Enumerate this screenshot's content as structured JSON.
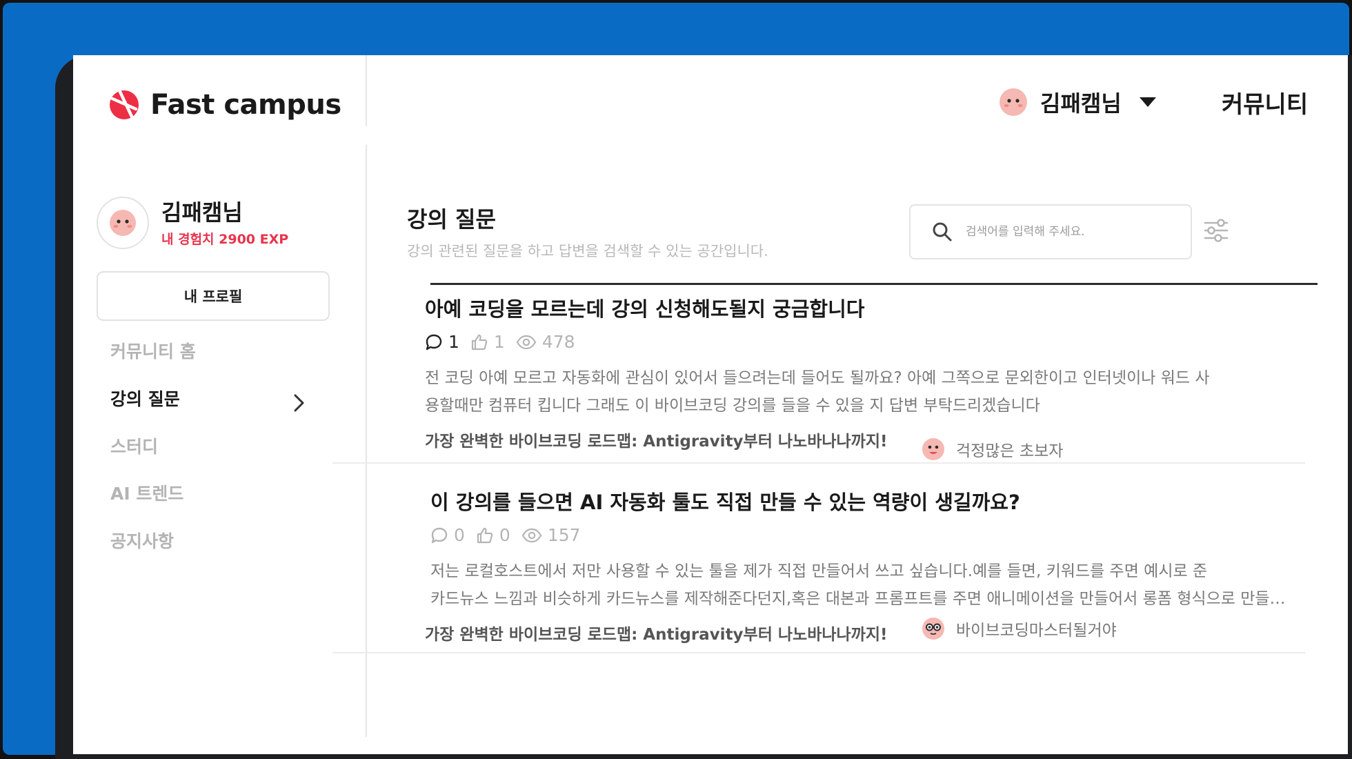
{
  "header": {
    "logo_text": "Fast campus",
    "user_name": "김패캠님",
    "community_label": "커뮤니티"
  },
  "sidebar": {
    "profile_name": "김패캠님",
    "profile_exp": "내 경험치 2900 EXP",
    "profile_button": "내 프로필",
    "nav": [
      {
        "label": "커뮤니티 홈"
      },
      {
        "label": "강의 질문"
      },
      {
        "label": "스터디"
      },
      {
        "label": "AI 트렌드"
      },
      {
        "label": "공지사항"
      }
    ]
  },
  "main": {
    "title": "강의 질문",
    "description": "강의 관련된 질문을 하고 답변을 검색할 수 있는 공간입니다.",
    "search_placeholder": "검색어를 입력해 주세요."
  },
  "posts": [
    {
      "title": "아예 코딩을 모르는데 강의 신청해도될지 궁금합니다",
      "comments": "1",
      "likes": "1",
      "views": "478",
      "body_line1": "전 코딩 아예 모르고 자동화에 관심이 있어서 들으려는데 들어도 될까요? 아예 그쪽으로 문외한이고 인터넷이나 워드 사",
      "body_line2": "용할때만 컴퓨터 킵니다 그래도 이 바이브코딩 강의를 들을 수 있을 지 답변 부탁드리겠습니다",
      "tag": "가장 완벽한 바이브코딩 로드맵: Antigravity부터 나노바나나까지!",
      "author": "걱정많은 초보자"
    },
    {
      "title": "이 강의를 들으면 AI  자동화  툴도 직접 만들 수 있는 역량이 생길까요?",
      "comments": "0",
      "likes": "0",
      "views": "157",
      "body_line1": "저는 로컬호스트에서 저만 사용할 수 있는 툴을 제가 직접 만들어서 쓰고 싶습니다.예를 들면, 키워드를 주면 예시로 준",
      "body_line2": "카드뉴스 느낌과 비슷하게 카드뉴스를 제작해준다던지,혹은 대본과 프롬프트를 주면 애니메이션을 만들어서 롱폼 형식으로 만들어 주는 툴",
      "tag": "가장 완벽한 바이브코딩 로드맵: Antigravity부터 나노바나나까지!",
      "author": "바이브코딩마스터될거야"
    }
  ],
  "colors": {
    "frame_blue": "#0a6bc4",
    "accent_red": "#e8344e",
    "avatar_pink": "#f6b8b2"
  }
}
